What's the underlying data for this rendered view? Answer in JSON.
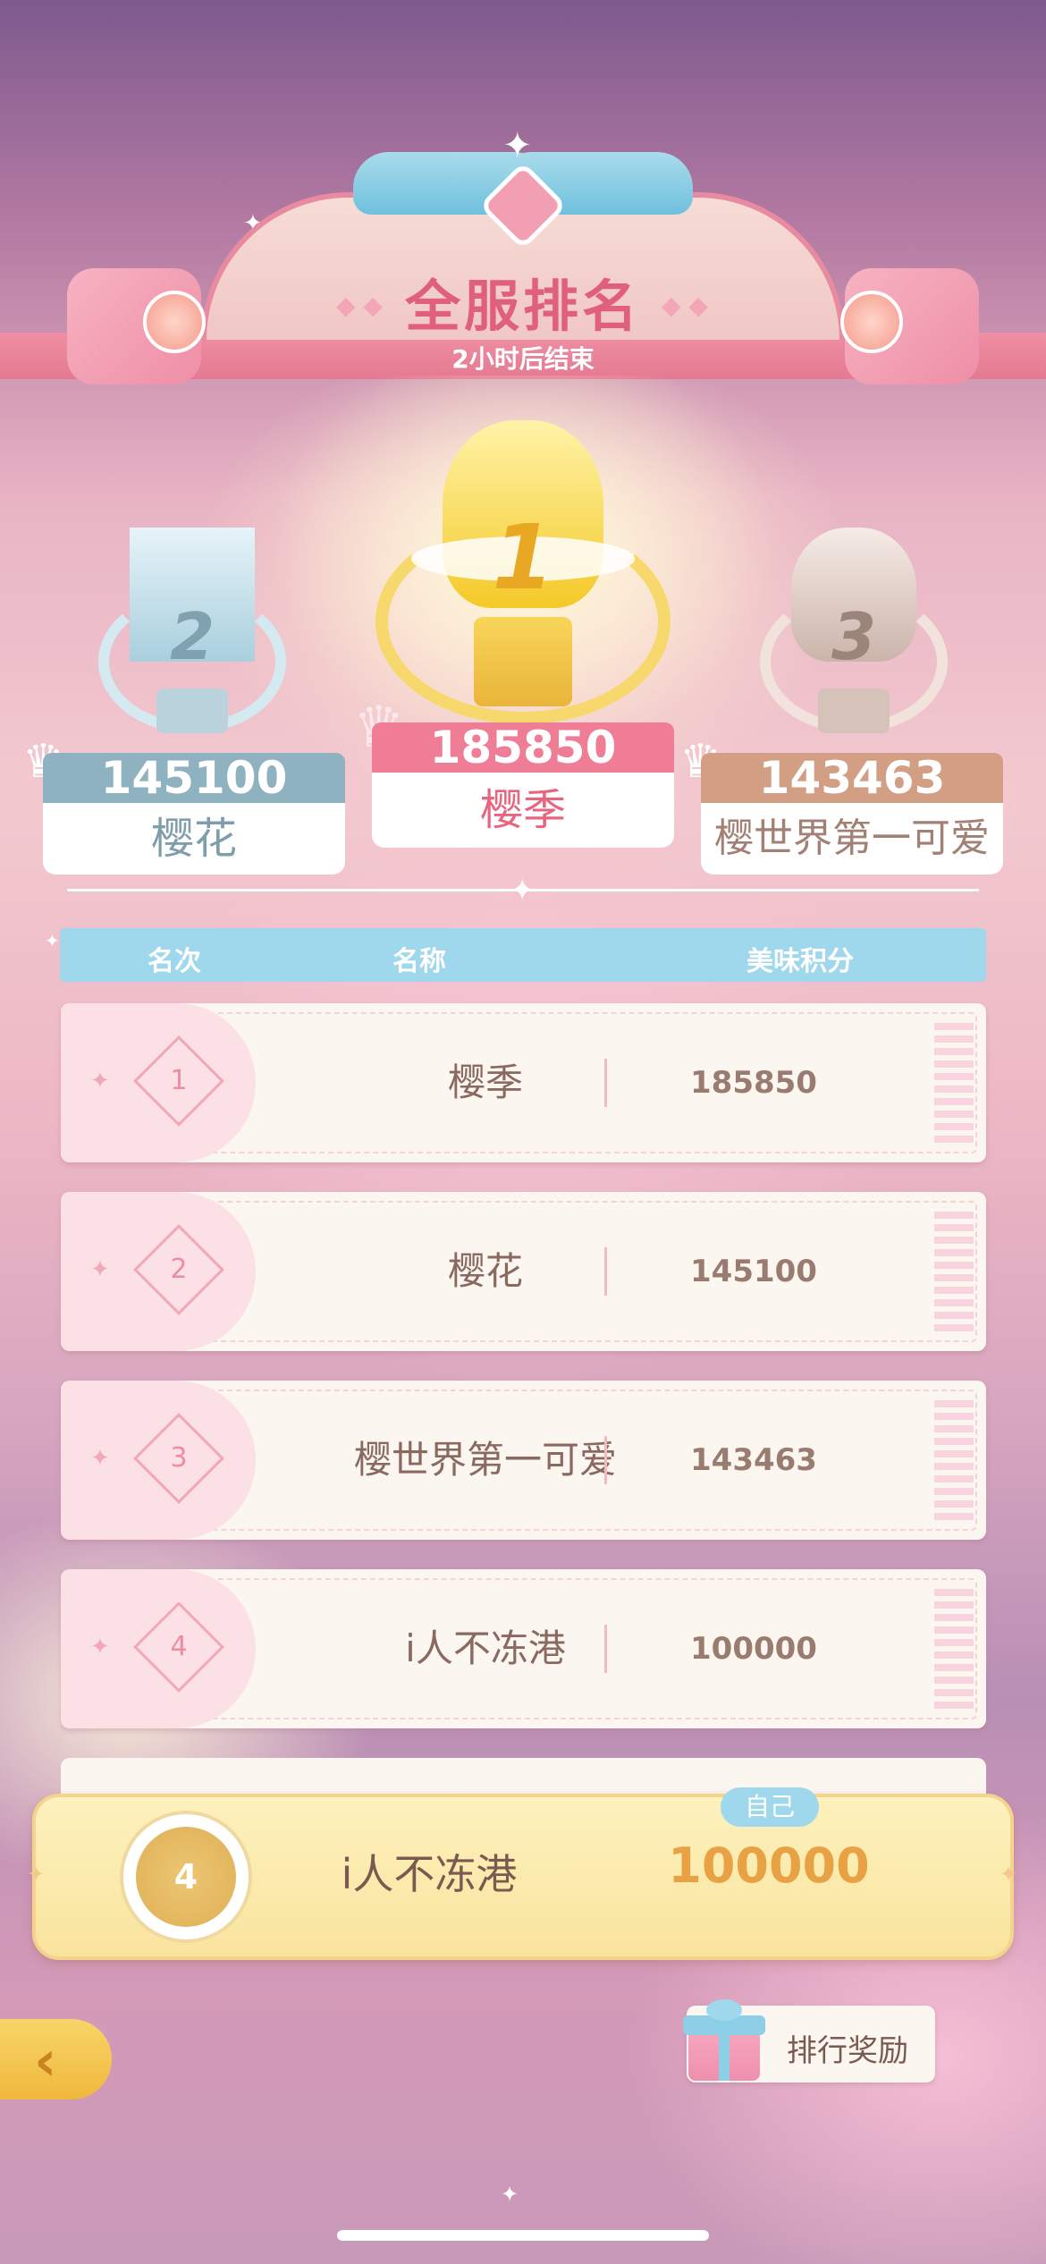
{
  "header": {
    "title": "全服排名",
    "subtitle": "2小时后结束"
  },
  "podium": [
    {
      "rank": "2",
      "score": "145100",
      "name": "樱花",
      "color": "#8fb2c1"
    },
    {
      "rank": "1",
      "score": "185850",
      "name": "樱季",
      "color": "#ef7d95"
    },
    {
      "rank": "3",
      "score": "143463",
      "name": "樱世界第一可爱",
      "color": "#d29e84"
    }
  ],
  "table": {
    "headers": {
      "rank": "名次",
      "name": "名称",
      "score": "美味积分"
    },
    "rows": [
      {
        "rank": "1",
        "name": "樱季",
        "score": "185850"
      },
      {
        "rank": "2",
        "name": "樱花",
        "score": "145100"
      },
      {
        "rank": "3",
        "name": "樱世界第一可爱",
        "score": "143463"
      },
      {
        "rank": "4",
        "name": "i人不冻港",
        "score": "100000"
      }
    ]
  },
  "self": {
    "tag": "自己",
    "rank": "4",
    "name": "i人不冻港",
    "score": "100000"
  },
  "buttons": {
    "reward": "排行奖励"
  },
  "colors": {
    "accent_pink": "#e0607c",
    "header_blue": "#9fd7ec",
    "gold": "#e8a244"
  }
}
